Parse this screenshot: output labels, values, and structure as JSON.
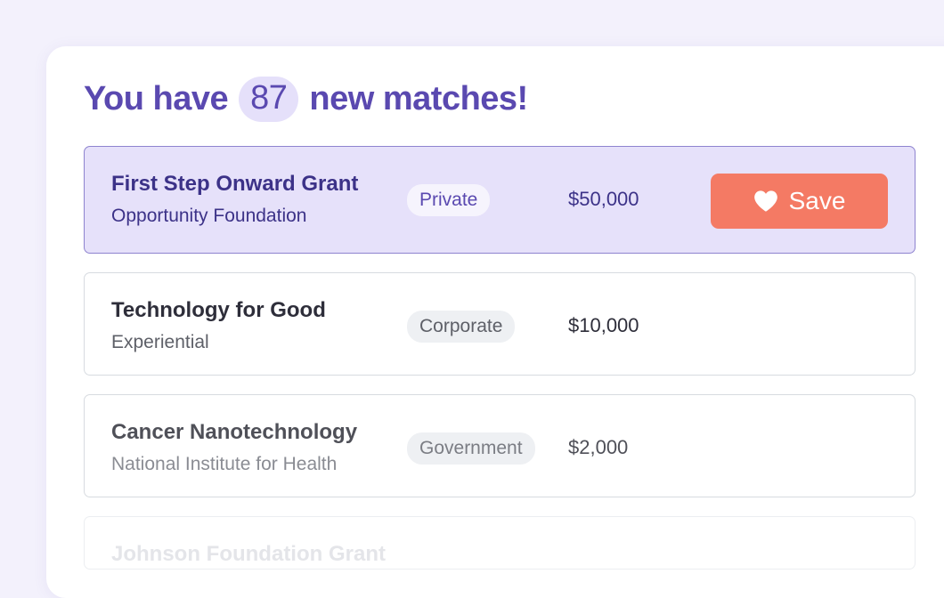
{
  "header": {
    "prefix": "You have",
    "count": "87",
    "suffix": "new matches!"
  },
  "matches": [
    {
      "name": "First Step Onward Grant",
      "org": "Opportunity Foundation",
      "type": "Private",
      "amount": "$50,000",
      "selected": true,
      "action": {
        "label": "Save",
        "icon": "heart-icon"
      }
    },
    {
      "name": "Technology for Good",
      "org": "Experiential",
      "type": "Corporate",
      "amount": "$10,000"
    },
    {
      "name": "Cancer Nanotechnology",
      "org": "National Institute for Health",
      "type": "Government",
      "amount": "$2,000"
    },
    {
      "name": "Johnson Foundation Grant"
    }
  ],
  "colors": {
    "accent": "#5a49b0",
    "selected_bg": "#e6e1fa",
    "save_button": "#f47a64",
    "page_bg": "#f3f1fc"
  }
}
